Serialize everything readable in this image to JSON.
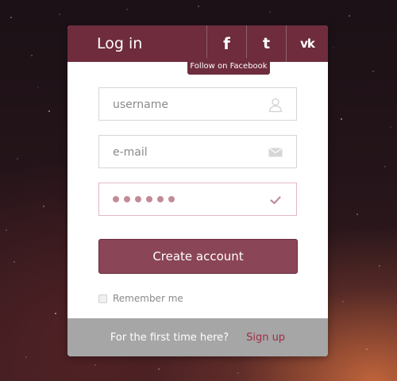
{
  "header": {
    "title": "Log in",
    "social": [
      {
        "name": "facebook",
        "glyph": "f"
      },
      {
        "name": "twitter",
        "glyph": "t"
      },
      {
        "name": "vk",
        "glyph": "vk"
      }
    ]
  },
  "tooltip": {
    "text": "Follow on Facebook"
  },
  "form": {
    "username_placeholder": "username",
    "email_placeholder": "e-mail",
    "password_masked_count": 6,
    "submit_label": "Create account",
    "remember_label": "Remember me"
  },
  "footer": {
    "text": "For the first time here?",
    "signup_label": "Sign up"
  },
  "colors": {
    "accent": "#6e2c3d",
    "button": "#8a4556",
    "link": "#9e2d45"
  }
}
